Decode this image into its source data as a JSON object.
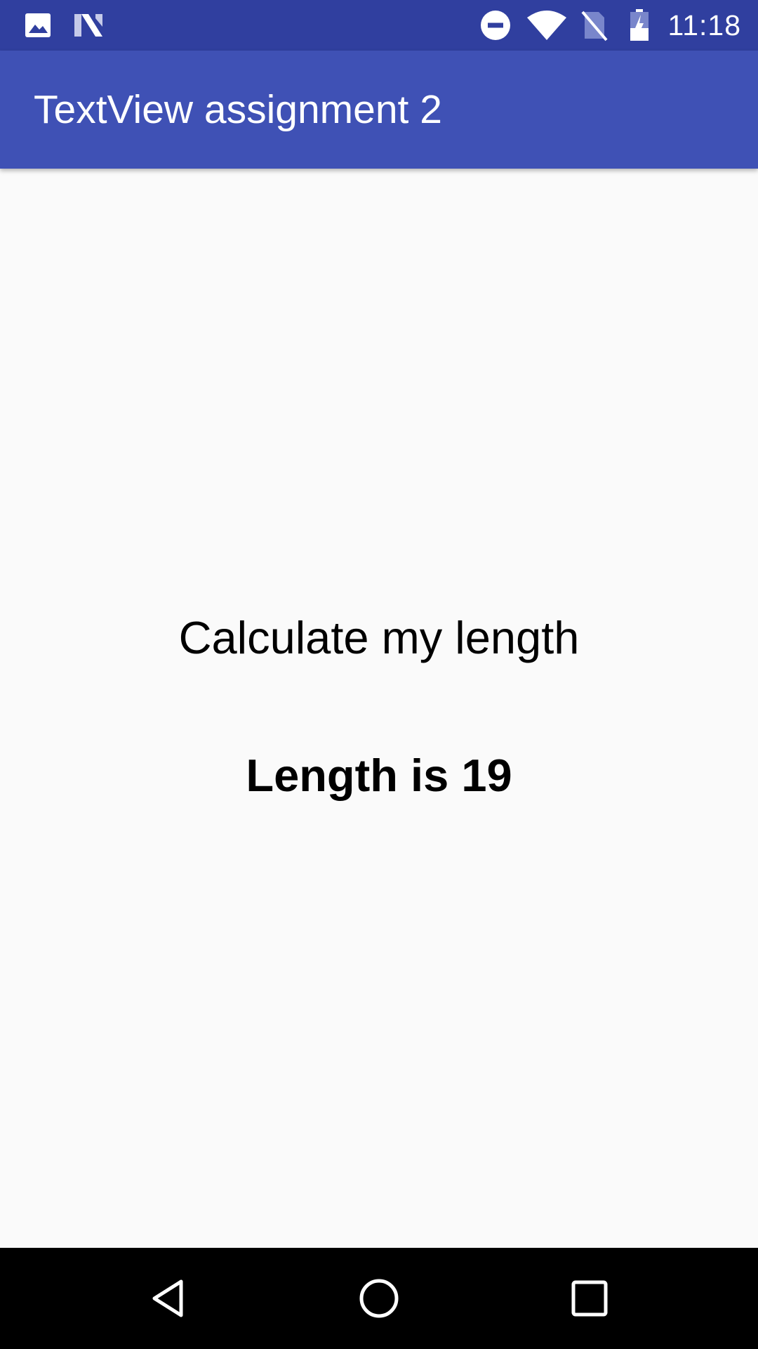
{
  "status_bar": {
    "time": "11:18",
    "left_icons": [
      "image-notification-icon",
      "n-notification-icon"
    ],
    "right_icons": [
      "do-not-disturb-icon",
      "wifi-icon",
      "no-sim-icon",
      "battery-charging-icon"
    ]
  },
  "app_bar": {
    "title": "TextView assignment 2"
  },
  "content": {
    "input_text": "Calculate my length",
    "result_text": "Length is 19"
  },
  "nav_bar": {
    "buttons": [
      "back-icon",
      "home-icon",
      "recents-icon"
    ]
  },
  "colors": {
    "status_bar": "#303F9F",
    "primary": "#3F51B5",
    "background": "#FAFAFA",
    "text": "#000000",
    "nav_bar": "#000000"
  }
}
